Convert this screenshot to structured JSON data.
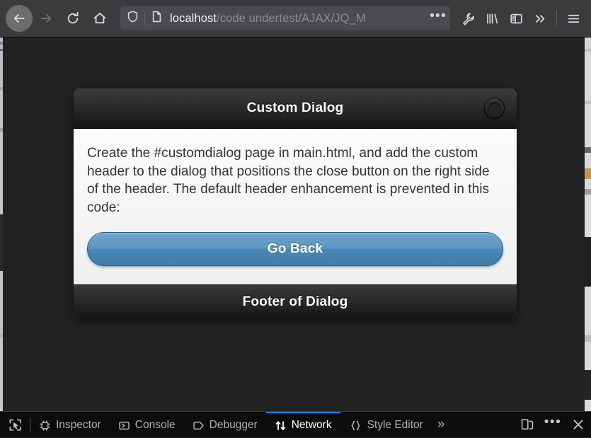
{
  "browser": {
    "nav": {
      "back_label": "Back",
      "forward_label": "Forward",
      "reload_label": "Reload",
      "home_label": "Home"
    },
    "urlbar": {
      "shield_icon": "shield-icon",
      "page_icon": "page-icon",
      "host": "localhost",
      "path": "/code undertest/AJAX/JQ_M",
      "overflow_label": "•••"
    },
    "toolbar_icons": [
      {
        "name": "wrench-icon",
        "label": "Web Developer Tools"
      },
      {
        "name": "library-icon",
        "label": "Library"
      },
      {
        "name": "sidebar-icon",
        "label": "Sidebars"
      },
      {
        "name": "chevron-double-right-icon",
        "label": "More Tools"
      },
      {
        "name": "hamburger-menu-icon",
        "label": "Open Application Menu"
      }
    ]
  },
  "dialog": {
    "header_title": "Custom Dialog",
    "close_label": "Close",
    "body_text": "Create the #customdialog page in main.html, and add the custom header to the dialog that positions the close button on the right side of the header. The default header enhancement is prevented in this code:",
    "button_label": "Go Back",
    "footer_title": "Footer of Dialog",
    "accent_button_color": "#4a87b4",
    "header_bg_color": "#222222"
  },
  "devtools": {
    "picker_icon": "element-picker-icon",
    "tabs": [
      {
        "label": "Inspector",
        "icon": "inspector-icon",
        "active": false
      },
      {
        "label": "Console",
        "icon": "console-icon",
        "active": false
      },
      {
        "label": "Debugger",
        "icon": "debugger-icon",
        "active": false
      },
      {
        "label": "Network",
        "icon": "network-icon",
        "active": true
      },
      {
        "label": "Style Editor",
        "icon": "style-editor-icon",
        "active": false
      }
    ],
    "overflow_label": "»",
    "active_tab_color": "#0a84ff",
    "right_buttons": [
      {
        "name": "responsive-design-mode-icon",
        "label": "Responsive Design Mode"
      },
      {
        "name": "meatball-menu-icon",
        "label": "Customize Developer Tools"
      },
      {
        "name": "close-devtools-icon",
        "label": "Close Developer Tools"
      }
    ]
  }
}
